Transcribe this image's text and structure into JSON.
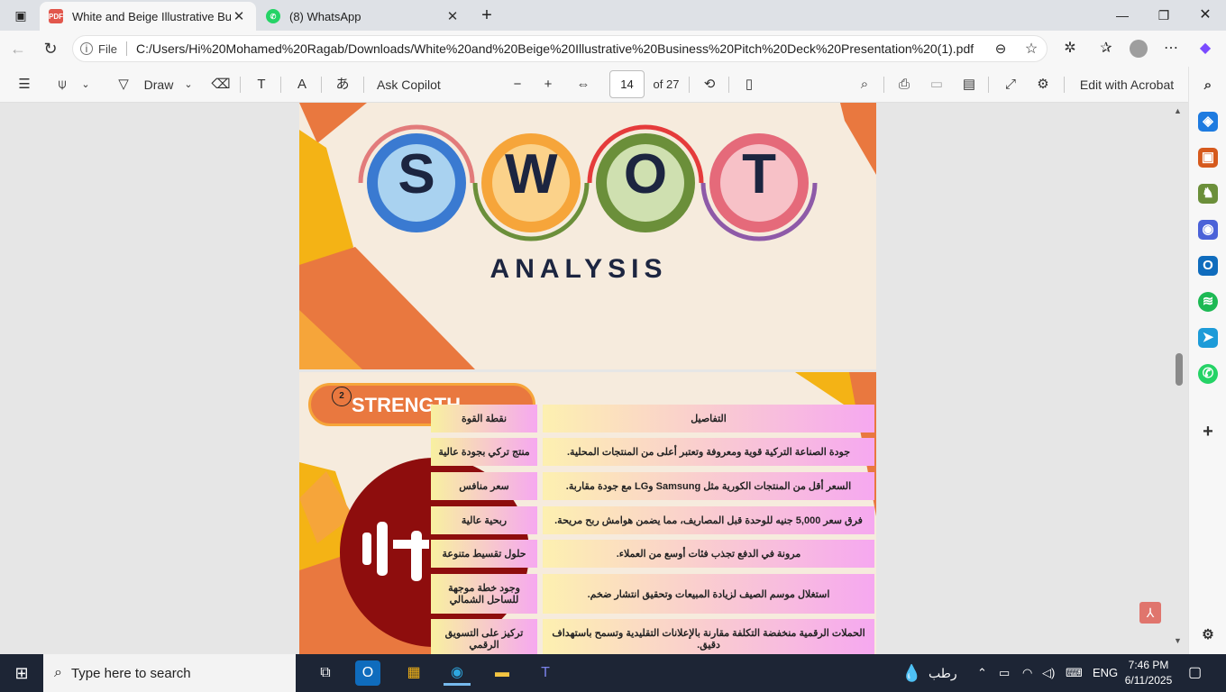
{
  "tabs": [
    {
      "title": "White and Beige Illustrative Busin",
      "icon": "pdf-icon",
      "color": "#e2574c"
    },
    {
      "title": "(8) WhatsApp",
      "icon": "whatsapp-icon",
      "color": "#25d366"
    }
  ],
  "address": {
    "scheme_label": "File",
    "url": "C:/Users/Hi%20Mohamed%20Ragab/Downloads/White%20and%20Beige%20Illustrative%20Business%20Pitch%20Deck%20Presentation%20(1).pdf"
  },
  "pdf_toolbar": {
    "draw_label": "Draw",
    "ask_copilot": "Ask Copilot",
    "page_number": "14",
    "page_of": "of 27",
    "edit_acrobat": "Edit with Acrobat"
  },
  "slide1": {
    "letters": [
      "S",
      "W",
      "O",
      "T"
    ],
    "subtitle": "ANALYSIS"
  },
  "slide2": {
    "badge_number": "2",
    "heading": "STRENGTH",
    "header": {
      "left": "نقطة القوة",
      "right": "التفاصيل"
    },
    "rows": [
      {
        "left": "منتج تركي بجودة عالية",
        "right": "جودة الصناعة التركية قوية ومعروفة وتعتبر أعلى من المنتجات المحلية."
      },
      {
        "left": "سعر منافس",
        "right": "السعر أقل من المنتجات الكورية مثل Samsung وLG مع جودة مقاربة."
      },
      {
        "left": "ربحية عالية",
        "right": "فرق سعر 5,000 جنيه للوحدة قبل المصاريف، مما يضمن هوامش ربح مريحة."
      },
      {
        "left": "حلول تقسيط متنوعة",
        "right": "مرونة في الدفع تجذب فئات أوسع من العملاء."
      },
      {
        "left": "وجود خطة موجهة للساحل الشمالي",
        "right": "استغلال موسم الصيف لزيادة المبيعات وتحقيق انتشار ضخم."
      },
      {
        "left": "تركيز على التسويق الرقمي",
        "right": "الحملات الرقمية منخفضة التكلفة مقارنة بالإعلانات التقليدية وتسمح باستهداف دقيق."
      }
    ]
  },
  "taskbar": {
    "search_placeholder": "Type here to search",
    "weather": "رطب",
    "lang": "ENG",
    "time": "7:46 PM",
    "date": "6/11/2025"
  }
}
